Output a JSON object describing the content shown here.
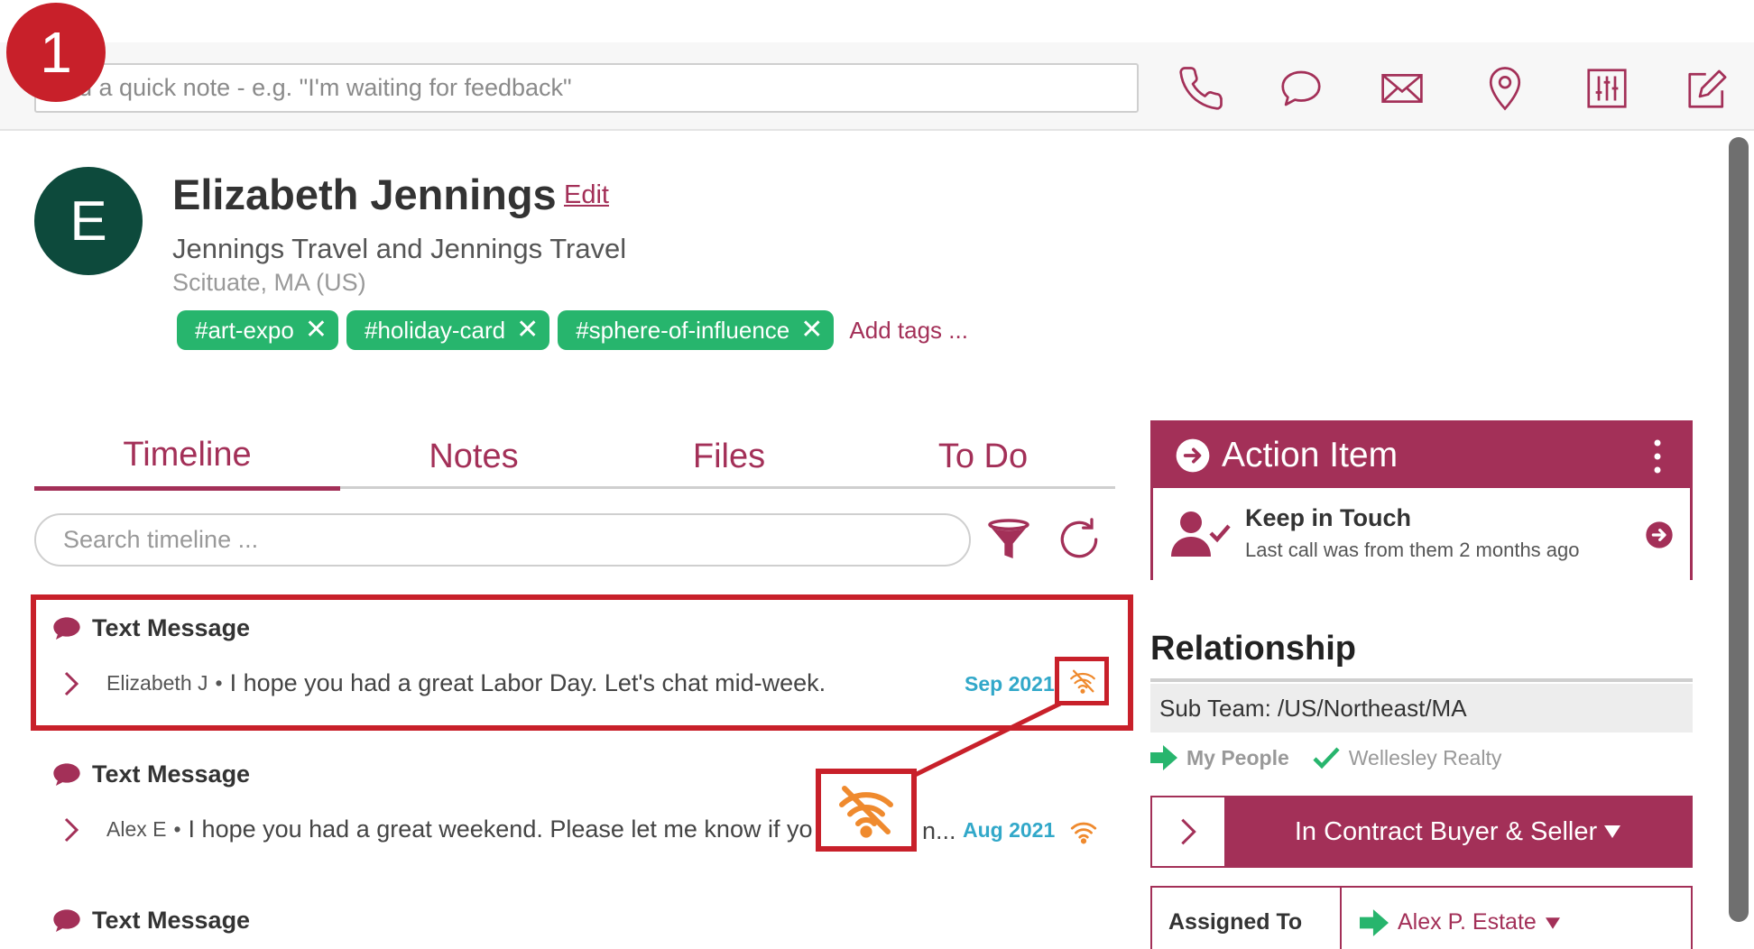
{
  "step_badge": "1",
  "quick_note": {
    "placeholder": "Add a quick note - e.g. \"I'm waiting for feedback\""
  },
  "top_icons": [
    "phone-icon",
    "chat-bubble-icon",
    "envelope-icon",
    "map-pin-icon",
    "sliders-icon",
    "edit-note-icon"
  ],
  "contact": {
    "initial": "E",
    "name": "Elizabeth Jennings",
    "edit_label": "Edit",
    "company": "Jennings Travel and Jennings Travel",
    "location": "Scituate, MA (US)",
    "tags": [
      "#art-expo",
      "#holiday-card",
      "#sphere-of-influence"
    ],
    "tag_remove": "✕",
    "add_tags": "Add tags ..."
  },
  "tabs": [
    "Timeline",
    "Notes",
    "Files",
    "To Do"
  ],
  "active_tab": "Timeline",
  "timeline": {
    "search_placeholder": "Search timeline ...",
    "entries": [
      {
        "type": "Text Message",
        "sender": "Elizabeth J",
        "separator": "•",
        "message": "I hope you had a great Labor Day. Let's chat mid-week.",
        "date": "Sep 2021",
        "status_icon": "eye-slash-wifi-icon"
      },
      {
        "type": "Text Message",
        "sender": "Alex E",
        "separator": "•",
        "message": "I hope you had a great weekend. Please let me know if yo",
        "message_tail": "n...",
        "date": "Aug 2021",
        "status_icon": "wifi-icon"
      },
      {
        "type": "Text Message"
      }
    ]
  },
  "action_item": {
    "title": "Action Item",
    "main": "Keep in Touch",
    "sub": "Last call was from them 2 months ago"
  },
  "relationship": {
    "title": "Relationship",
    "sub_team": "Sub Team: /US/Northeast/MA",
    "my_people": "My People",
    "company": "Wellesley Realty",
    "stage": "In Contract Buyer & Seller",
    "assigned_label": "Assigned To",
    "assigned_value": "Alex P. Estate"
  },
  "colors": {
    "brand": "#a33058",
    "tag_green": "#27b56d",
    "date_blue": "#32a8c9",
    "status_orange": "#ef8a2e",
    "annotation_red": "#c8202a",
    "avatar_green": "#0d4a3c"
  }
}
